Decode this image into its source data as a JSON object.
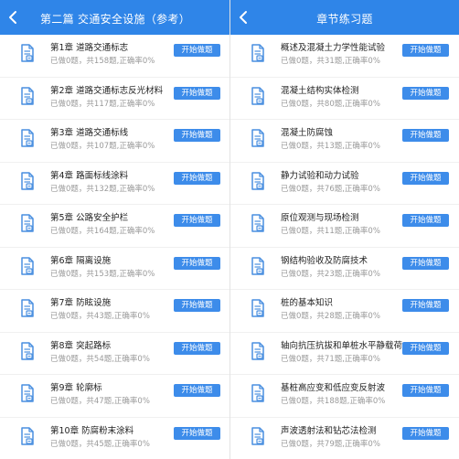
{
  "colors": {
    "header": "#2f85e8",
    "button": "#3d8cea",
    "icon": "#4a8fe0"
  },
  "left": {
    "title": "第二篇  交通安全设施（参考）",
    "button_label": "开始做题",
    "items": [
      {
        "name": "第1章   道路交通标志",
        "meta": "已做0题，共158题,正确率0%"
      },
      {
        "name": "第2章   道路交通标志反光材料",
        "meta": "已做0题，共117题,正确率0%"
      },
      {
        "name": "第3章   道路交通标线",
        "meta": "已做0题，共107题,正确率0%"
      },
      {
        "name": "第4章   路面标线涂料",
        "meta": "已做0题，共132题,正确率0%"
      },
      {
        "name": "第5章   公路安全护栏",
        "meta": "已做0题，共164题,正确率0%"
      },
      {
        "name": "第6章   隔离设施",
        "meta": "已做0题，共153题,正确率0%"
      },
      {
        "name": "第7章   防眩设施",
        "meta": "已做0题，共43题,正确率0%"
      },
      {
        "name": "第8章   突起路标",
        "meta": "已做0题，共54题,正确率0%"
      },
      {
        "name": "第9章   轮廓标",
        "meta": "已做0题，共47题,正确率0%"
      },
      {
        "name": "第10章   防腐粉末涂料",
        "meta": "已做0题，共45题,正确率0%"
      }
    ]
  },
  "right": {
    "title": "章节练习题",
    "button_label": "开始做题",
    "items": [
      {
        "name": "概述及混凝土力学性能试验",
        "meta": "已做0题，共31题,正确率0%"
      },
      {
        "name": "混凝土结构实体检测",
        "meta": "已做0题，共80题,正确率0%"
      },
      {
        "name": "混凝土防腐蚀",
        "meta": "已做0题，共13题,正确率0%"
      },
      {
        "name": "静力试验和动力试验",
        "meta": "已做0题，共76题,正确率0%"
      },
      {
        "name": "原位观测与现场检测",
        "meta": "已做0题，共11题,正确率0%"
      },
      {
        "name": "钢结构验收及防腐技术",
        "meta": "已做0题，共23题,正确率0%"
      },
      {
        "name": "桩的基本知识",
        "meta": "已做0题，共28题,正确率0%"
      },
      {
        "name": "轴向抗压抗拔和单桩水平静载荷",
        "meta": "已做0题，共71题,正确率0%"
      },
      {
        "name": "基桩高应变和低应变反射波",
        "meta": "已做0题，共188题,正确率0%"
      },
      {
        "name": "声波透射法和钻芯法检测",
        "meta": "已做0题，共79题,正确率0%"
      }
    ]
  }
}
